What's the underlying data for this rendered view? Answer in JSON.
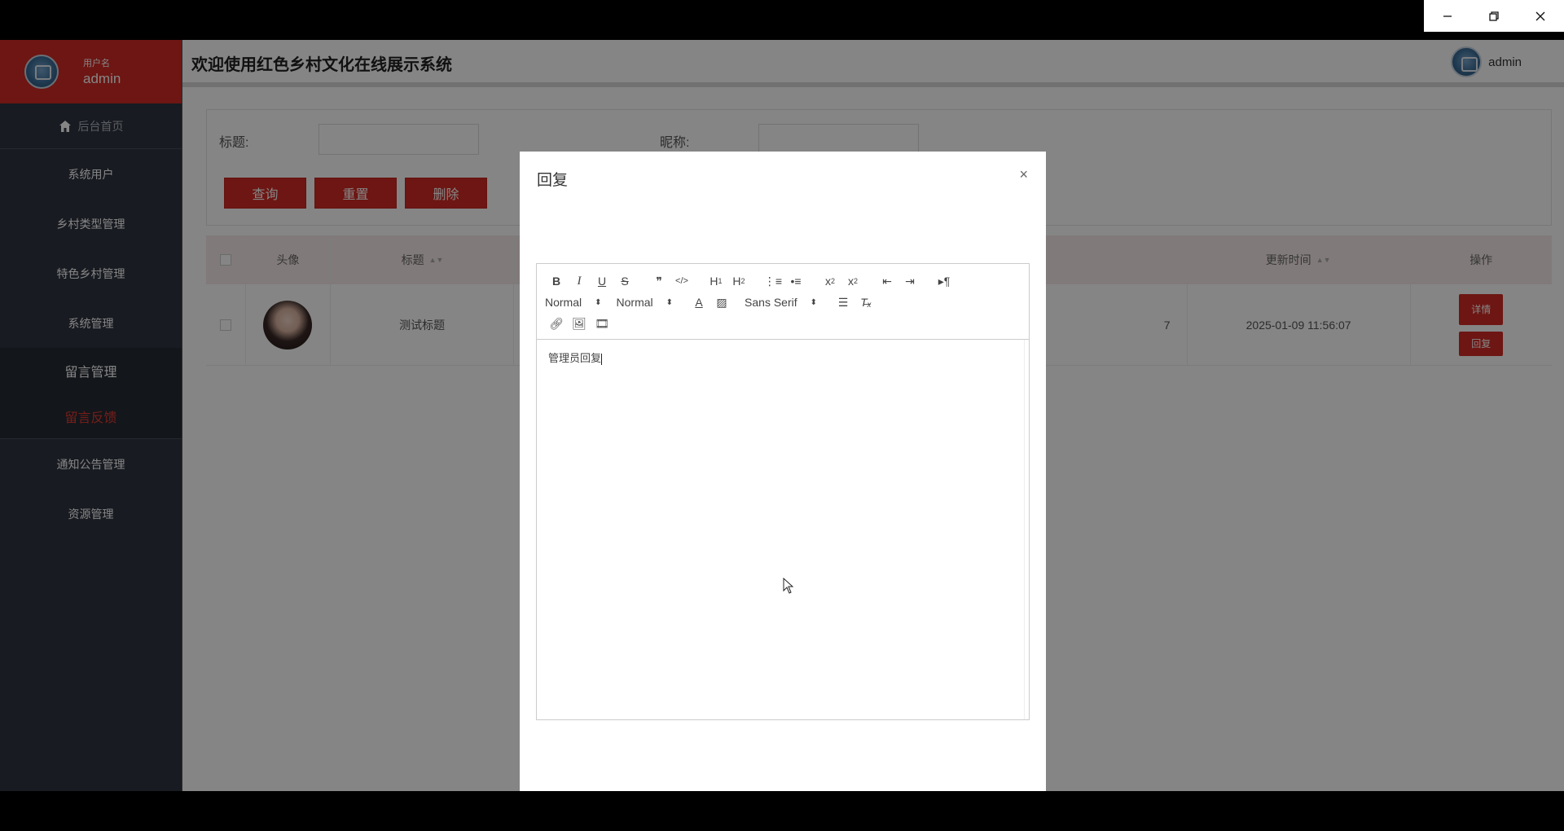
{
  "app": {
    "title": "欢迎使用红色乡村文化在线展示系统",
    "header_user": "admin"
  },
  "sidebar": {
    "user_label": "用户名",
    "user_name": "admin",
    "home": "后台首页",
    "items": [
      {
        "label": "系统用户"
      },
      {
        "label": "乡村类型管理"
      },
      {
        "label": "特色乡村管理"
      },
      {
        "label": "系统管理"
      }
    ],
    "group": {
      "label": "留言管理",
      "sub": "留言反馈"
    },
    "items_after": [
      {
        "label": "通知公告管理"
      },
      {
        "label": "资源管理"
      }
    ]
  },
  "search": {
    "title_label": "标题:",
    "nickname_label": "昵称:",
    "query": "查询",
    "reset": "重置",
    "delete": "删除"
  },
  "table": {
    "headers": {
      "avatar": "头像",
      "title": "标题",
      "updated": "更新时间",
      "actions": "操作"
    },
    "rows": [
      {
        "title": "测试标题",
        "partial": "7",
        "updated": "2025-01-09 11:56:07",
        "detail": "详情",
        "reply": "回复"
      }
    ]
  },
  "modal": {
    "title": "回复",
    "close": "×",
    "editor": {
      "header_picker": "Normal",
      "size_picker": "Normal",
      "font_picker": "Sans Serif",
      "content": "管理员回复"
    }
  },
  "colors": {
    "accent": "#d12b25",
    "sidebar": "#2f3540"
  }
}
